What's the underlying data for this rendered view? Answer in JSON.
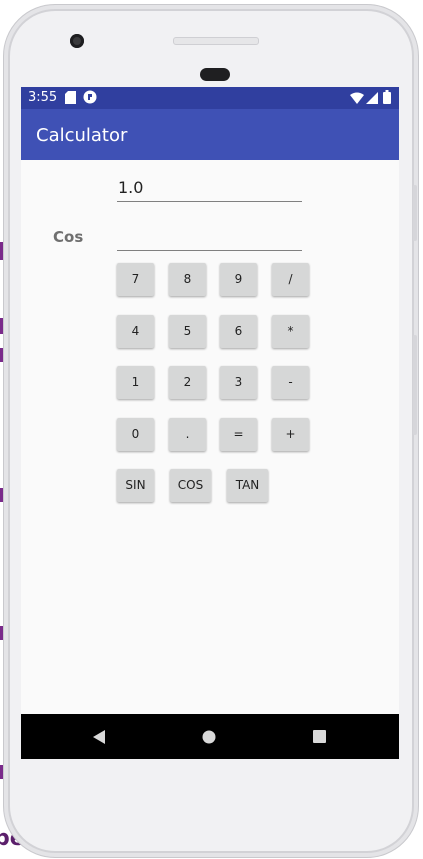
{
  "background": {
    "partial_text": "ber"
  },
  "status_bar": {
    "time": "3:55",
    "icons": [
      "sd-card-icon",
      "app-notification-icon",
      "wifi-icon",
      "signal-icon",
      "battery-icon"
    ]
  },
  "app_bar": {
    "title": "Calculator",
    "color": "#3f51b5",
    "status_color": "#303f9f"
  },
  "inputs": {
    "first_value": "1.0",
    "second_value": "",
    "operator_label": "Cos"
  },
  "keypad": {
    "rows": [
      [
        "7",
        "8",
        "9",
        "/"
      ],
      [
        "4",
        "5",
        "6",
        "*"
      ],
      [
        "1",
        "2",
        "3",
        "-"
      ],
      [
        "0",
        ".",
        "=",
        "+"
      ]
    ],
    "functions": [
      "SIN",
      "COS",
      "TAN"
    ]
  },
  "nav_bar": {
    "buttons": [
      "back-icon",
      "home-icon",
      "recents-icon"
    ]
  }
}
